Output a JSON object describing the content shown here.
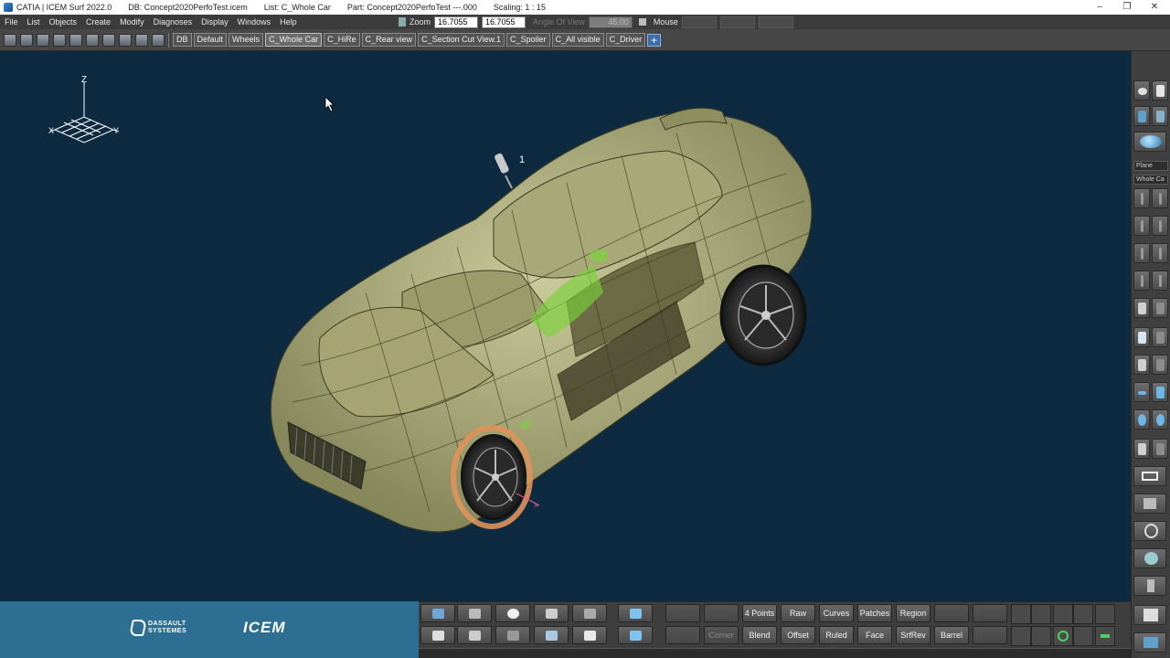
{
  "titlebar": {
    "app": "CATIA | ICEM Surf 2022.0",
    "db": "DB: Concept2020PerfoTest.icem",
    "list": "List: C_Whole Car",
    "part": "Part: Concept2020PerfoTest ---.000",
    "scaling": "Scaling: 1 : 15",
    "minimize": "–",
    "restore": "❐",
    "close": "✕"
  },
  "menu": [
    "File",
    "List",
    "Objects",
    "Create",
    "Modify",
    "Diagnoses",
    "Display",
    "Windows",
    "Help"
  ],
  "zoom": {
    "label": "Zoom",
    "value1": "16.7055",
    "value2": "16.7055",
    "angle_label": "Angle Of View",
    "angle_value": "45.00",
    "mouse_label": "Mouse"
  },
  "view_tabs": [
    "DB",
    "Default",
    "Wheels",
    "C_Whole Car",
    "C_HiRe",
    "C_Rear view",
    "C_Section Cut View.1",
    "C_Spoiler",
    "C_All visible",
    "C_Driver"
  ],
  "view_tab_add": "+",
  "axes": {
    "z": "Z",
    "x": "X",
    "y": "Y"
  },
  "viewport_label": "1",
  "right_panel": {
    "select1": "Plane",
    "select2": "Whole Ca"
  },
  "brand": {
    "ds_line1": "DASSAULT",
    "ds_line2": "SYSTEMES",
    "icem": "ICEM"
  },
  "commands_row1": [
    "4 Points",
    "Raw",
    "Curves",
    "Patches",
    "Region"
  ],
  "commands_row2": [
    "Corner",
    "Blend",
    "Offset",
    "Ruled",
    "Face",
    "SrfRev",
    "Barrel"
  ],
  "colors": {
    "viewport_bg": "#0d2a40",
    "car_body": "#b7b683",
    "wheel_highlight": "#e0925a",
    "selection_green": "#7bd33a",
    "brand_blue": "#2d6e93"
  }
}
